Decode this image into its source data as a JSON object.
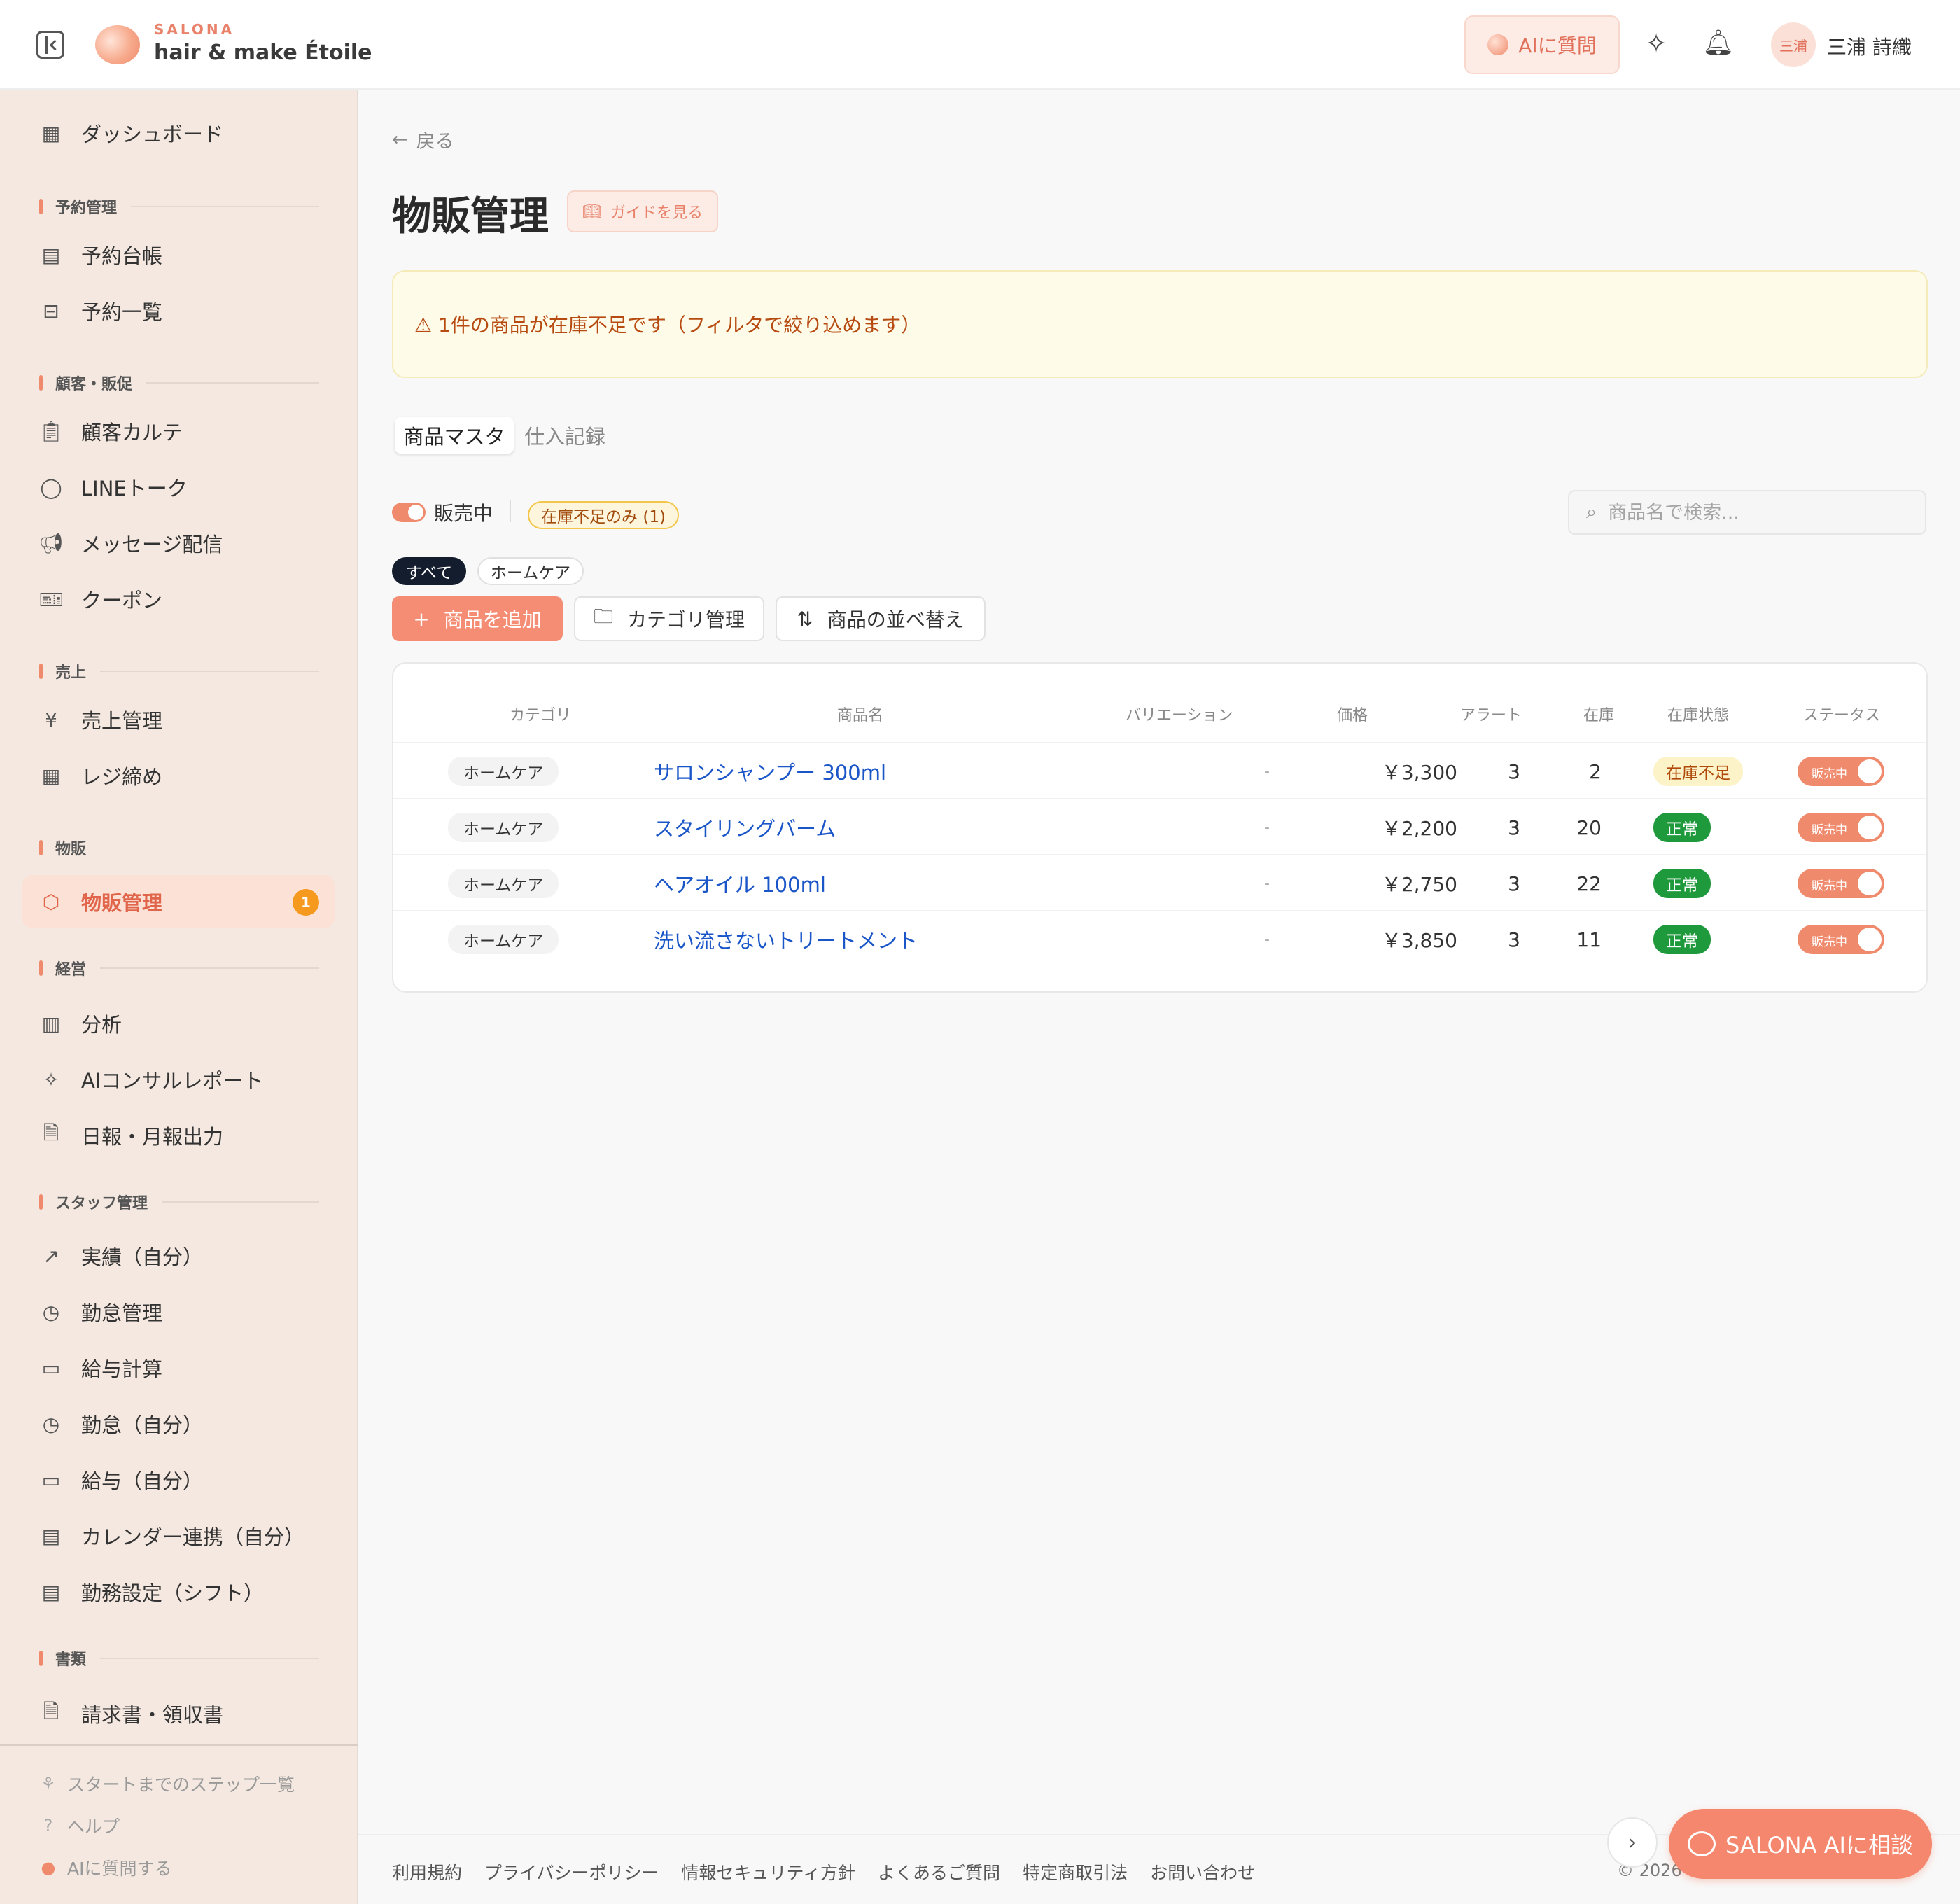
{
  "header": {
    "brand_small": "SALONA",
    "brand_name": "hair & make Étoile",
    "ai_button": "AIに質問",
    "avatar_text": "三浦",
    "user_name": "三浦 詩織"
  },
  "sidebar": {
    "dashboard": "ダッシュボード",
    "sections": {
      "reservation": "予約管理",
      "customer": "顧客・販促",
      "sales": "売上",
      "merch": "物販",
      "management": "経営",
      "staff": "スタッフ管理",
      "docs": "書類"
    },
    "items": {
      "reservation_ledger": "予約台帳",
      "reservation_list": "予約一覧",
      "customer_chart": "顧客カルテ",
      "line_talk": "LINEトーク",
      "message": "メッセージ配信",
      "coupon": "クーポン",
      "sales_management": "売上管理",
      "register_close": "レジ締め",
      "merch_management": "物販管理",
      "analysis": "分析",
      "ai_report": "AIコンサルレポート",
      "daily_report": "日報・月報出力",
      "performance": "実績（自分）",
      "attendance_mgmt": "勤怠管理",
      "payroll": "給与計算",
      "attendance_self": "勤怠（自分）",
      "salary_self": "給与（自分）",
      "calendar": "カレンダー連携（自分）",
      "shift": "勤務設定（シフト）",
      "invoice": "請求書・領収書"
    },
    "merch_badge": "1",
    "footer": {
      "steps": "スタートまでのステップ一覧",
      "help": "ヘルプ",
      "ask_ai": "AIに質問する"
    }
  },
  "main": {
    "back": "戻る",
    "title": "物販管理",
    "guide": "ガイドを見る",
    "alert": "⚠ 1件の商品が在庫不足です（フィルタで絞り込めます）",
    "tabs": [
      "商品マスタ",
      "仕入記録"
    ],
    "filter_on_sale": "販売中",
    "filter_low_stock": "在庫不足のみ (1)",
    "search_placeholder": "商品名で検索...",
    "category_chips": [
      "すべて",
      "ホームケア"
    ],
    "buttons": {
      "add": "商品を追加",
      "category": "カテゴリ管理",
      "sort": "商品の並べ替え"
    }
  },
  "table": {
    "headers": [
      "カテゴリ",
      "商品名",
      "バリエーション",
      "価格",
      "アラート",
      "在庫",
      "在庫状態",
      "ステータス"
    ],
    "rows": [
      {
        "category": "ホームケア",
        "name": "サロンシャンプー 300ml",
        "variation": "-",
        "price": "￥3,300",
        "alert": "3",
        "stock": "2",
        "stock_state": "在庫不足",
        "status": "販売中"
      },
      {
        "category": "ホームケア",
        "name": "スタイリングバーム",
        "variation": "-",
        "price": "￥2,200",
        "alert": "3",
        "stock": "20",
        "stock_state": "正常",
        "status": "販売中"
      },
      {
        "category": "ホームケア",
        "name": "ヘアオイル 100ml",
        "variation": "-",
        "price": "￥2,750",
        "alert": "3",
        "stock": "22",
        "stock_state": "正常",
        "status": "販売中"
      },
      {
        "category": "ホームケア",
        "name": "洗い流さないトリートメント",
        "variation": "-",
        "price": "￥3,850",
        "alert": "3",
        "stock": "11",
        "stock_state": "正常",
        "status": "販売中"
      }
    ]
  },
  "footer": {
    "links": [
      "利用規約",
      "プライバシーポリシー",
      "情報セキュリティ方針",
      "よくあるご質問",
      "特定商取引法",
      "お問い合わせ"
    ],
    "copyright": "© 2026",
    "ai_fab": "SALONA AIに相談"
  },
  "colors": {
    "accent": "#f08a6c",
    "sidebar_bg": "#f4e8e0",
    "link": "#1a56c8",
    "ok": "#1e9a3c",
    "warn_bg": "#fdf3c8"
  }
}
